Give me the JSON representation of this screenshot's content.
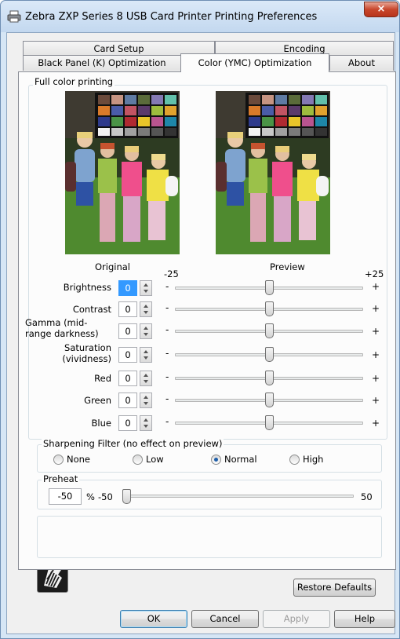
{
  "window": {
    "title": "Zebra ZXP Series 8 USB Card Printer Printing Preferences",
    "close_glyph": "×"
  },
  "tabs": {
    "row_back": [
      "Card Setup",
      "Encoding"
    ],
    "row_front": [
      "Black Panel (K) Optimization",
      "Color (YMC) Optimization",
      "About"
    ],
    "active": "Color (YMC) Optimization"
  },
  "full_color": {
    "group_label": "Full color printing",
    "original_label": "Original",
    "preview_label": "Preview",
    "scale_min": "-25",
    "scale_max": "+25",
    "minus": "-",
    "plus": "+",
    "controls": [
      {
        "label": "Brightness",
        "value": "0",
        "level": 0.5
      },
      {
        "label": "Contrast",
        "value": "0",
        "level": 0.5
      },
      {
        "label": "Gamma (mid-",
        "label2": "range darkness)",
        "value": "0",
        "level": 0.5
      },
      {
        "label": "Saturation",
        "label2": "(vividness)",
        "value": "0",
        "level": 0.5
      },
      {
        "label": "Red",
        "value": "0",
        "level": 0.5
      },
      {
        "label": "Green",
        "value": "0",
        "level": 0.5
      },
      {
        "label": "Blue",
        "value": "0",
        "level": 0.5
      }
    ]
  },
  "sharpening": {
    "group_label": "Sharpening Filter (no effect on preview)",
    "options": [
      "None",
      "Low",
      "Normal",
      "High"
    ],
    "selected": "Normal"
  },
  "preheat": {
    "group_label": "Preheat",
    "value": "-50",
    "unit": "%",
    "min": "-50",
    "max": "50",
    "level": 0.0
  },
  "buttons": {
    "restore_defaults": "Restore Defaults",
    "ok": "OK",
    "cancel": "Cancel",
    "apply": "Apply",
    "help": "Help"
  },
  "colors": {
    "title_bg": "#c3d8ef",
    "close_red": "#c8472c",
    "radio_dot": "#1f5fa9",
    "focus_blue": "#3399ff"
  }
}
